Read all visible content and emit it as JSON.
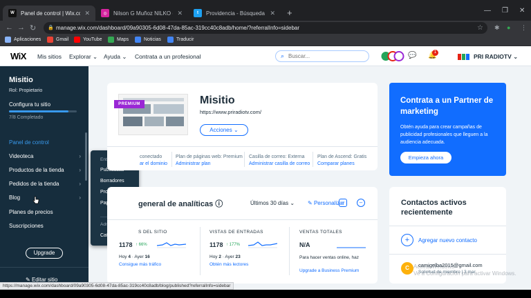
{
  "browser": {
    "tabs": [
      {
        "favicon": "wix-icon",
        "favicon_color": "#111111",
        "title": "Panel de control | Wix.com",
        "active": true
      },
      {
        "favicon": "instagram-icon",
        "favicon_color": "#d6249f",
        "title": "Nilson G Muñoz NILKO (@nilson",
        "active": false
      },
      {
        "favicon": "twitter-icon",
        "favicon_color": "#1da1f2",
        "title": "Providencia - Búsqueda de Twitt",
        "active": false
      }
    ],
    "url": "manage.wix.com/dashboard/09a90305-6d08-47da-85ac-319cc40c8adb/home/?referralInfo=sidebar",
    "bookmarks": [
      {
        "label": "Aplicaciones",
        "icon_color": "#8ab4f8"
      },
      {
        "label": "Gmail",
        "icon_color": "#ea4335"
      },
      {
        "label": "YouTube",
        "icon_color": "#ff0000"
      },
      {
        "label": "Maps",
        "icon_color": "#34a853"
      },
      {
        "label": "Noticias",
        "icon_color": "#4285f4"
      },
      {
        "label": "Traducir",
        "icon_color": "#4285f4"
      }
    ],
    "status_url": "https://manage.wix.com/dashboard/09a90305-6d08-47da-85ac-319cc40c8adb/blog/published?referralInfo=sidebar"
  },
  "header": {
    "logo": "WiX",
    "nav": [
      "Mis sitios",
      "Explorar",
      "Ayuda",
      "Contrata a un profesional"
    ],
    "search_placeholder": "Buscar...",
    "notifications_count": "1",
    "site_name": "PRI RADIOTV"
  },
  "sidebar": {
    "site_name": "Misitio",
    "role": "Rol: Propietario",
    "setup_label": "Configura tu sitio",
    "setup_progress": 0.88,
    "setup_completed": "7/8 Completado",
    "items": [
      {
        "label": "Panel de control",
        "active": true,
        "chevron": false
      },
      {
        "label": "Videoteca",
        "active": false,
        "chevron": true
      },
      {
        "label": "Productos de la tienda",
        "active": false,
        "chevron": true
      },
      {
        "label": "Pedidos de la tienda",
        "active": false,
        "chevron": true
      },
      {
        "label": "Blog",
        "active": false,
        "chevron": true
      },
      {
        "label": "Planes de precios",
        "active": false,
        "chevron": false
      },
      {
        "label": "Suscripciones",
        "active": false,
        "chevron": false
      }
    ],
    "upgrade_label": "Upgrade",
    "edit_label": "Editar sitio"
  },
  "blog_flyout": {
    "section1": "Entradas",
    "section1_items": [
      "Publicadas",
      "Borradores",
      "Programadas",
      "Papelera"
    ],
    "section2": "Administrar",
    "section2_items": [
      "Categorías"
    ]
  },
  "site_card": {
    "badge": "PREMIUM",
    "title": "Misitio",
    "url": "https://www.priradiotv.com/",
    "actions_label": "Acciones",
    "info": [
      {
        "label": "conectado",
        "link": "ar el dominio"
      },
      {
        "label": "Plan de páginas web: Premium",
        "link": "Administrar plan"
      },
      {
        "label": "Casilla de correo: Externa",
        "link": "Administrar casilla de correo"
      },
      {
        "label": "Plan de Ascend: Gratis",
        "link": "Comparar planes"
      }
    ]
  },
  "analytics": {
    "title": "general de analíticas",
    "period": "Últimos 30 días",
    "personalize": "Personalizar",
    "metrics": [
      {
        "label": "S DEL SITIO",
        "value": "1178",
        "change": "66%",
        "sub_a_label": "Hoy",
        "sub_a_value": "4",
        "sub_b_label": "Ayer",
        "sub_b_value": "16",
        "link": "Consigue más tráfico"
      },
      {
        "label": "VISTAS DE ENTRADAS",
        "value": "1178",
        "change": "177%",
        "sub_a_label": "Hoy",
        "sub_a_value": "2",
        "sub_b_label": "Ayer",
        "sub_b_value": "23",
        "link": "Obtén más lectores"
      },
      {
        "label": "VENTAS TOTALES",
        "value": "N/A",
        "change": "",
        "note": "Para hacer ventas online, haz",
        "link": "Upgrade a Business Premium"
      }
    ]
  },
  "partner": {
    "title": "Contrata a un Partner de marketing",
    "description": "Obtén ayuda para crear campañas de publicidad profesionales que lleguen a la audiencia adecuada.",
    "button": "Empieza ahora"
  },
  "contacts": {
    "title": "Contactos activos recientemente",
    "add_label": "Agregar nuevo contacto",
    "items": [
      {
        "initial": "C",
        "email": "camigelba2015@gmail.com",
        "note": "Solicitud de miembro | 3 mar"
      }
    ]
  },
  "watermark": {
    "line1": "Activar Windows",
    "line2": "Ve a Configuración para activar Windows."
  },
  "colors": {
    "accent": "#116dff",
    "sidebar": "#162d3d",
    "premium": "#9a27d5",
    "positive": "#25a55a"
  }
}
